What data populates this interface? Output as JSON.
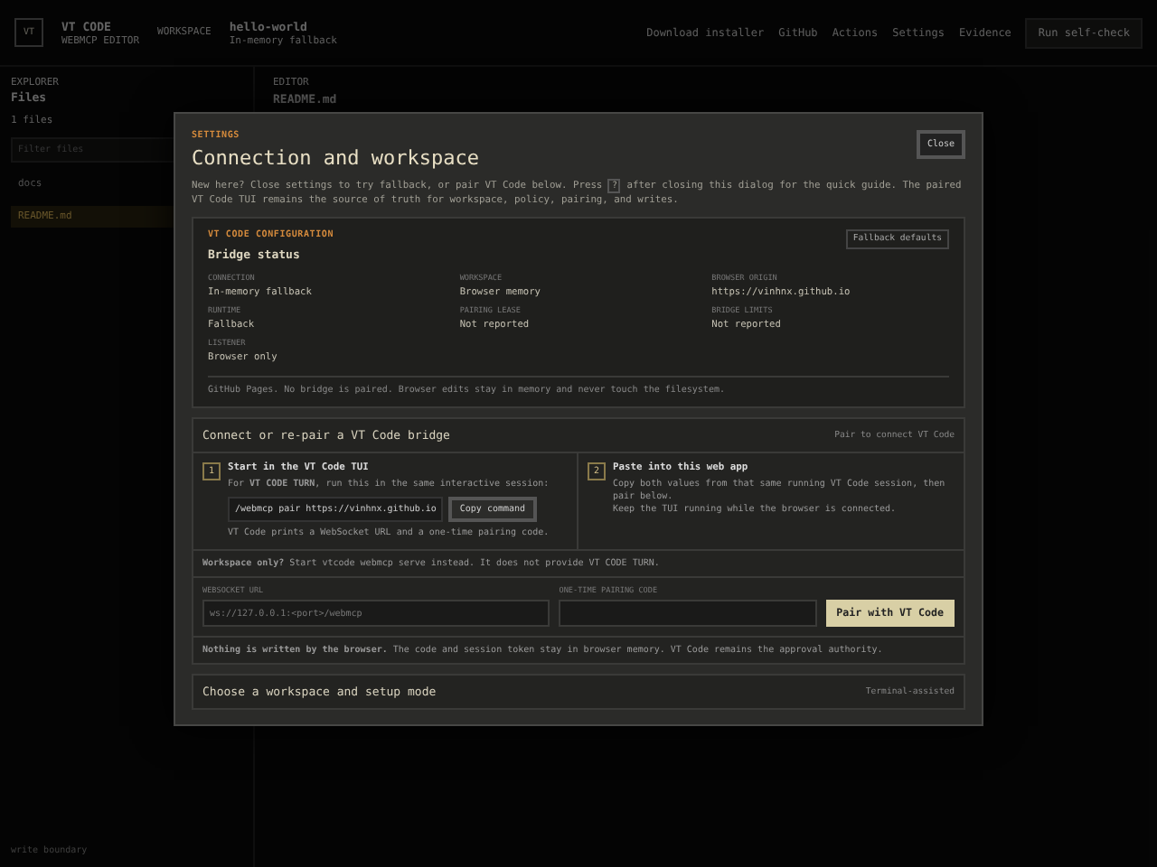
{
  "header": {
    "logo_mark": "VT",
    "app_name": "VT CODE",
    "app_subtitle": "WEBMCP EDITOR",
    "workspace_label": "WORKSPACE",
    "workspace_name": "hello-world",
    "workspace_meta": "In-memory fallback",
    "actions": [
      {
        "label": "Download installer",
        "kind": "link"
      },
      {
        "label": "GitHub",
        "kind": "link"
      },
      {
        "label": "Actions",
        "kind": "link"
      },
      {
        "label": "Settings",
        "kind": "link"
      },
      {
        "label": "Evidence",
        "kind": "link"
      },
      {
        "label": "Run self-check",
        "kind": "button"
      }
    ]
  },
  "explorer": {
    "eyebrow": "EXPLORER",
    "title": "Files",
    "count": "1 files",
    "filter_placeholder": "Filter files",
    "tree": [
      {
        "label": "docs",
        "selected": false
      },
      {
        "label": "README.md",
        "selected": true
      }
    ]
  },
  "editor": {
    "eyebrow": "EDITOR",
    "file": "README.md"
  },
  "footer": {
    "label": "write boundary"
  },
  "dialog": {
    "eyebrow": "SETTINGS",
    "title": "Connection and workspace",
    "close": "Close",
    "intro_before": "New here? Close settings to try fallback, or pair VT Code below. Press",
    "intro_key": "?",
    "intro_after": "after closing this dialog for the quick guide. The paired VT Code TUI remains the source of truth for workspace, policy, pairing, and writes.",
    "config": {
      "eyebrow": "VT CODE CONFIGURATION",
      "title": "Bridge status",
      "button": "Fallback defaults",
      "fields": [
        {
          "label": "CONNECTION",
          "value": "In-memory fallback"
        },
        {
          "label": "WORKSPACE",
          "value": "Browser memory"
        },
        {
          "label": "BROWSER ORIGIN",
          "value": "https://vinhnx.github.io"
        },
        {
          "label": "RUNTIME",
          "value": "Fallback"
        },
        {
          "label": "PAIRING LEASE",
          "value": "Not reported"
        },
        {
          "label": "BRIDGE LIMITS",
          "value": "Not reported"
        },
        {
          "label": "LISTENER",
          "value": "Browser only"
        }
      ],
      "note": "GitHub Pages. No bridge is paired. Browser edits stay in memory and never touch the filesystem."
    },
    "bridge": {
      "title": "Connect or re-pair a VT Code bridge",
      "hint": "Pair to connect VT Code",
      "steps": [
        {
          "number": "1",
          "title": "Start in the VT Code TUI",
          "kind": "command",
          "text": "For **VT CODE TURN**, run this in the same interactive session:",
          "command": "/webmcp pair https://vinhnx.github.io",
          "button": "Copy command",
          "note": "VT Code prints a WebSocket URL and a one-time pairing code."
        },
        {
          "number": "2",
          "title": "Paste into this web app",
          "kind": "text",
          "lines": [
            "Copy both values from that same running VT Code session, then pair below.",
            "Keep the TUI running while the browser is connected."
          ]
        }
      ],
      "workspace_note": "**Workspace only?** Start vtcode webmcp serve instead. It does not provide VT CODE TURN.",
      "url_label": "WEBSOCKET URL",
      "url_placeholder": "ws://127.0.0.1:<port>/webmcp",
      "code_label": "ONE-TIME PAIRING CODE",
      "pair_button": "Pair with VT Code",
      "footnote": "**Nothing is written by the browser.** The code and session token stay in browser memory. VT Code remains the approval authority."
    },
    "setup": {
      "title": "Choose a workspace and setup mode",
      "hint": "Terminal-assisted"
    }
  }
}
